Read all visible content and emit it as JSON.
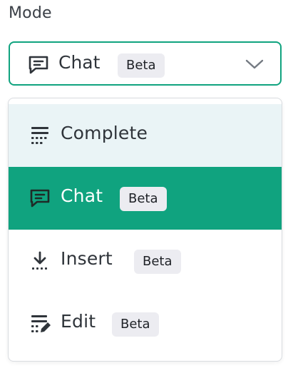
{
  "label": "Mode",
  "select": {
    "value": "Chat",
    "badge": "Beta",
    "icon": "chat-icon",
    "border_color": "#10a37f"
  },
  "options": [
    {
      "label": "Complete",
      "icon": "complete-icon",
      "badge": "",
      "state": "hovered"
    },
    {
      "label": "Chat",
      "icon": "chat-icon",
      "badge": "Beta",
      "state": "selected"
    },
    {
      "label": "Insert",
      "icon": "insert-icon",
      "badge": "Beta",
      "state": ""
    },
    {
      "label": "Edit",
      "icon": "edit-icon",
      "badge": "Beta",
      "state": ""
    }
  ],
  "colors": {
    "accent": "#10a37f",
    "hover": "#eaf4f6",
    "badge_bg": "#ececf1"
  }
}
